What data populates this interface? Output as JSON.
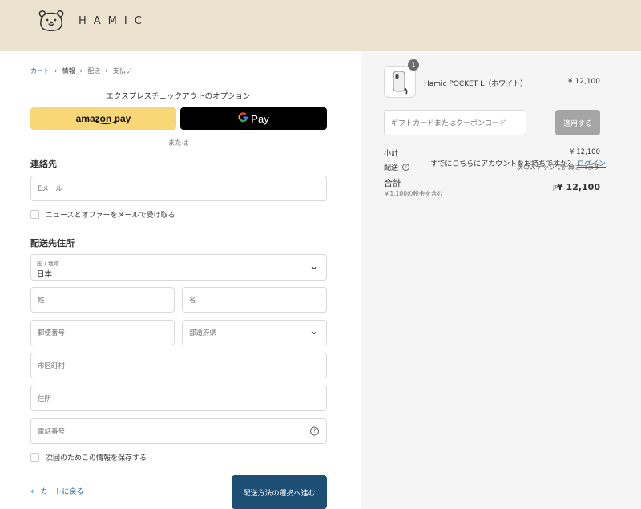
{
  "brand": {
    "name": "HAMIC",
    "logo_icon": "bear-face-icon"
  },
  "breadcrumb": {
    "items": [
      {
        "label": "カート",
        "state": "link"
      },
      {
        "label": "情報",
        "state": "current"
      },
      {
        "label": "配送",
        "state": "upcoming"
      },
      {
        "label": "支払い",
        "state": "upcoming"
      }
    ]
  },
  "express": {
    "title": "エクスプレスチェックアウトのオプション",
    "amazon_label": "amazon pay",
    "gpay_label": "Pay",
    "or_label": "または",
    "colors": {
      "amazon": "#fad776",
      "gpay": "#000000"
    }
  },
  "contact": {
    "heading": "連絡先",
    "account_question": "すでにこちらにアカウントをお持ちですか？",
    "login_link": "ログイン",
    "email_placeholder": "Eメール",
    "newsletter_label": "ニュースとオファーをメールで受け取る"
  },
  "shipping": {
    "heading": "配送先住所",
    "country_label": "国 / 地域",
    "country_value": "日本",
    "last_name_placeholder": "姓",
    "first_name_placeholder": "名",
    "postal_placeholder": "郵便番号",
    "prefecture_placeholder": "都道府県",
    "city_placeholder": "市区町村",
    "address_placeholder": "住所",
    "phone_placeholder": "電話番号",
    "save_info_label": "次回のためこの情報を保存する"
  },
  "footer": {
    "back_label": "カートに戻る",
    "continue_label": "配送方法の選択へ進む"
  },
  "summary": {
    "item": {
      "name": "Hamic POCKET L（ホワイト）",
      "price": "¥ 12,100",
      "quantity": "1"
    },
    "coupon_placeholder": "ギフトカードまたはクーポンコード",
    "apply_label": "適用する",
    "subtotal_label": "小計",
    "subtotal_value": "¥ 12,100",
    "shipping_label": "配送",
    "shipping_note": "次のステップで計算されます",
    "total_label": "合計",
    "tax_note": "￥1,100の税金を含む",
    "currency": "JPY",
    "total_value": "¥ 12,100"
  },
  "colors": {
    "header_bg": "#ece2d0",
    "primary_button": "#1d4f75",
    "link": "#1f6c99"
  }
}
